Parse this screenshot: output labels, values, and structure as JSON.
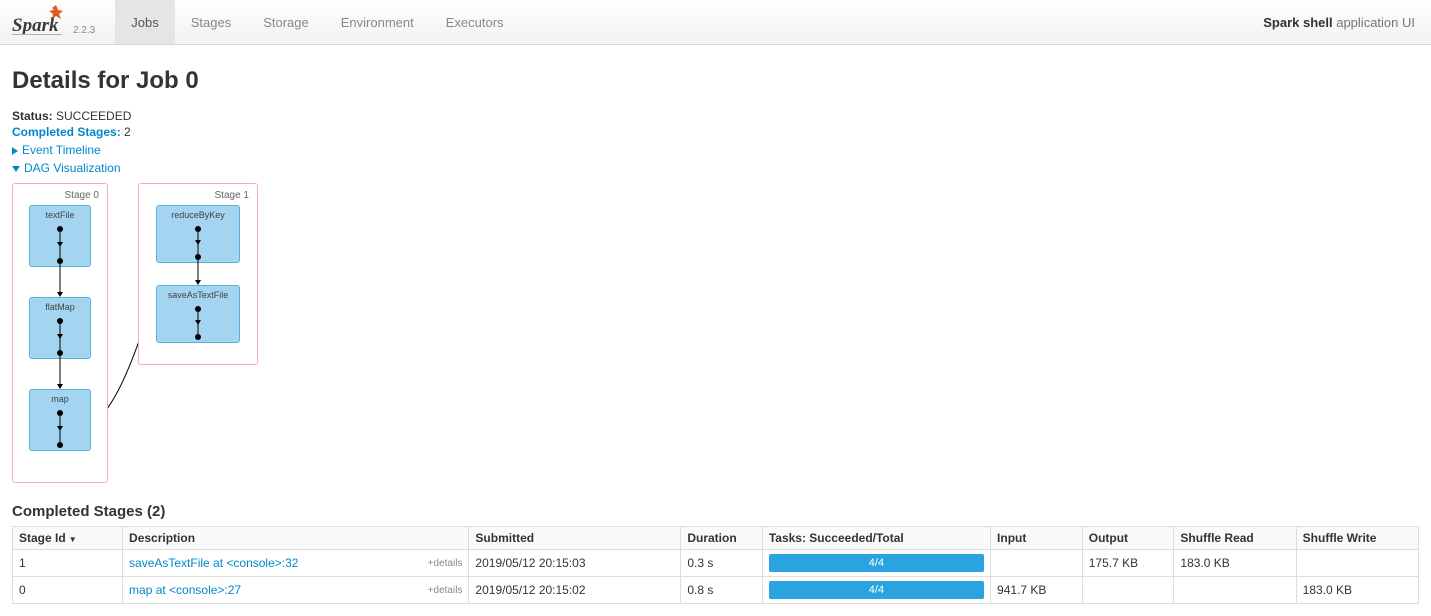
{
  "brand": {
    "version": "2.2.3"
  },
  "nav": {
    "tabs": [
      {
        "label": "Jobs",
        "active": true
      },
      {
        "label": "Stages",
        "active": false
      },
      {
        "label": "Storage",
        "active": false
      },
      {
        "label": "Environment",
        "active": false
      },
      {
        "label": "Executors",
        "active": false
      }
    ]
  },
  "app_title": {
    "bold": "Spark shell",
    "rest": " application UI"
  },
  "page_title": "Details for Job 0",
  "summary": {
    "status_label": "Status:",
    "status_value": "SUCCEEDED",
    "completed_label": "Completed Stages:",
    "completed_value": "2"
  },
  "expanders": {
    "timeline": "Event Timeline",
    "dag": "DAG Visualization"
  },
  "dag": {
    "stage0": {
      "title": "Stage 0",
      "ops": [
        "textFile",
        "flatMap",
        "map"
      ]
    },
    "stage1": {
      "title": "Stage 1",
      "ops": [
        "reduceByKey",
        "saveAsTextFile"
      ]
    }
  },
  "completed_stages": {
    "heading": "Completed Stages (2)",
    "cols": {
      "stage_id": "Stage Id",
      "description": "Description",
      "submitted": "Submitted",
      "duration": "Duration",
      "tasks": "Tasks: Succeeded/Total",
      "input": "Input",
      "output": "Output",
      "shuffle_read": "Shuffle Read",
      "shuffle_write": "Shuffle Write"
    },
    "details_label": "+details",
    "rows": [
      {
        "id": "1",
        "description": "saveAsTextFile at <console>:32",
        "submitted": "2019/05/12 20:15:03",
        "duration": "0.3 s",
        "tasks": "4/4",
        "input": "",
        "output": "175.7 KB",
        "shuffle_read": "183.0 KB",
        "shuffle_write": ""
      },
      {
        "id": "0",
        "description": "map at <console>:27",
        "submitted": "2019/05/12 20:15:02",
        "duration": "0.8 s",
        "tasks": "4/4",
        "input": "941.7 KB",
        "output": "",
        "shuffle_read": "",
        "shuffle_write": "183.0 KB"
      }
    ]
  }
}
